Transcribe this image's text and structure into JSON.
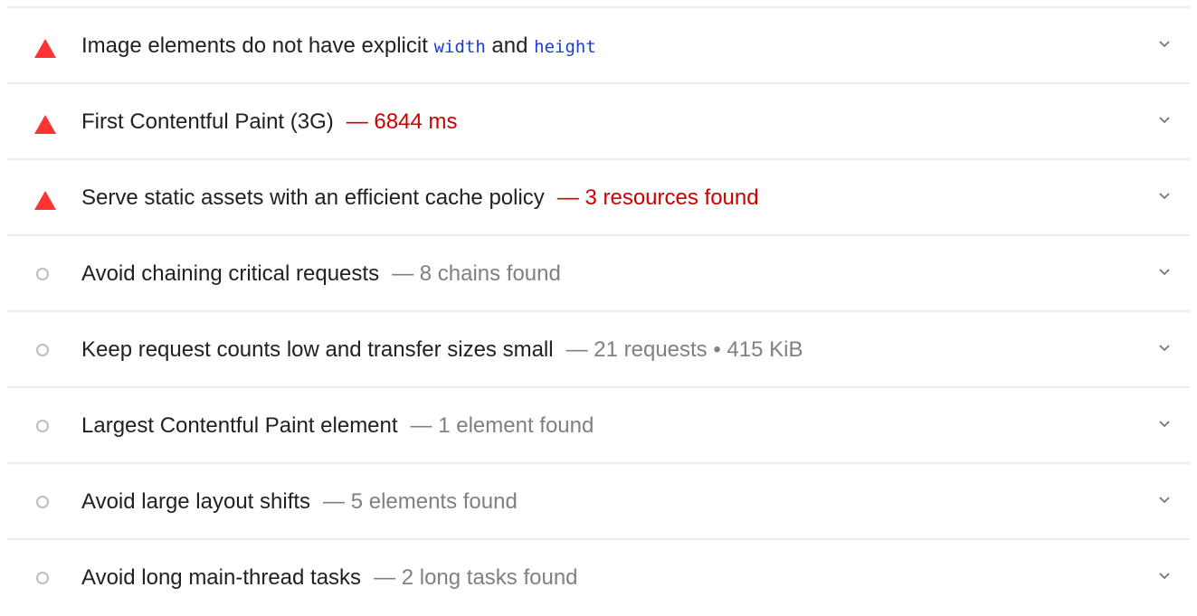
{
  "colors": {
    "fail": "#ff3333",
    "fail_text": "#cc0000",
    "neutral_text": "#808080",
    "code_text": "#1a3fcc",
    "divider": "#ebebeb"
  },
  "audits": [
    {
      "status": "fail",
      "icon": "warning-triangle-icon",
      "title_pre": "Image elements do not have explicit ",
      "code_1": "width",
      "title_mid": " and ",
      "code_2": "height",
      "display_value": ""
    },
    {
      "status": "fail",
      "icon": "warning-triangle-icon",
      "title": "First Contentful Paint (3G)",
      "display_value": "— 6844 ms"
    },
    {
      "status": "fail",
      "icon": "warning-triangle-icon",
      "title": "Serve static assets with an efficient cache policy",
      "display_value": "— 3 resources found"
    },
    {
      "status": "informative",
      "icon": "informative-circle-icon",
      "title": "Avoid chaining critical requests",
      "display_value": "— 8 chains found"
    },
    {
      "status": "informative",
      "icon": "informative-circle-icon",
      "title": "Keep request counts low and transfer sizes small",
      "display_value": "— 21 requests • 415 KiB"
    },
    {
      "status": "informative",
      "icon": "informative-circle-icon",
      "title": "Largest Contentful Paint element",
      "display_value": "— 1 element found"
    },
    {
      "status": "informative",
      "icon": "informative-circle-icon",
      "title": "Avoid large layout shifts",
      "display_value": "— 5 elements found"
    },
    {
      "status": "informative",
      "icon": "informative-circle-icon",
      "title": "Avoid long main-thread tasks",
      "display_value": "— 2 long tasks found"
    }
  ]
}
